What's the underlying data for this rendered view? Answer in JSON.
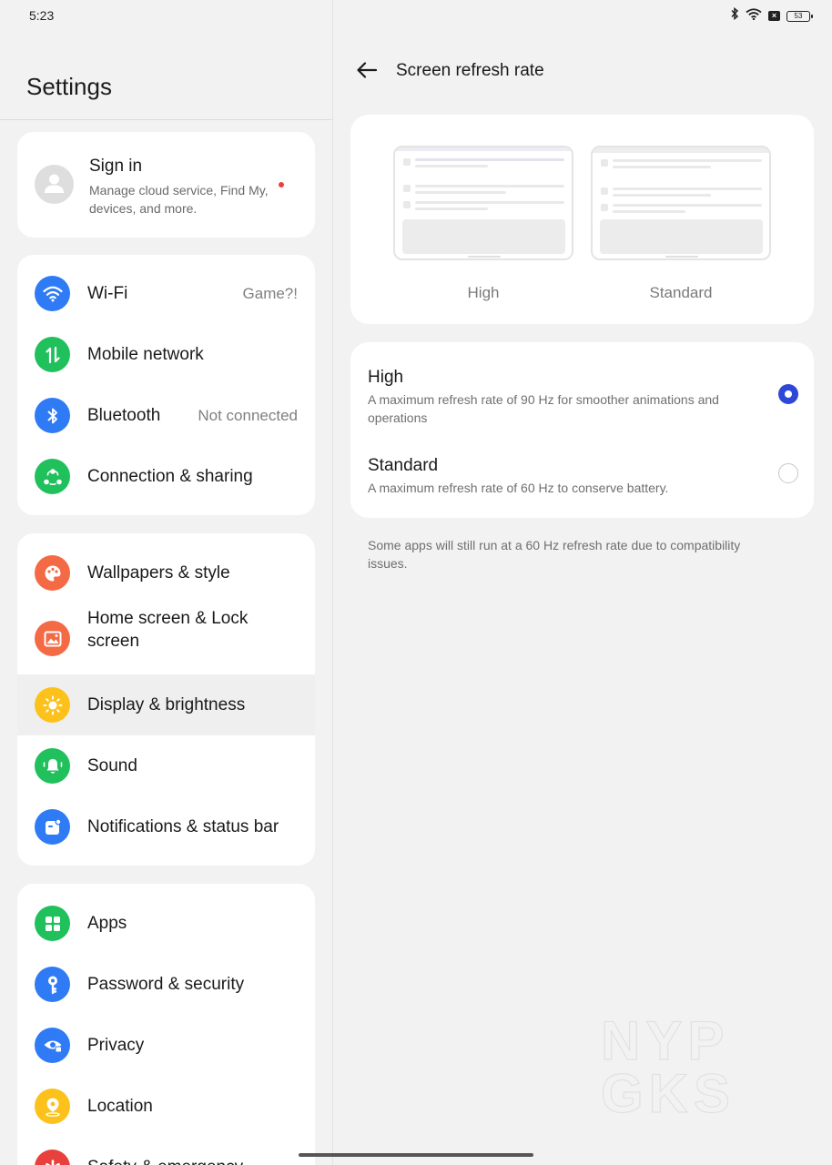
{
  "status": {
    "time": "5:23",
    "battery": "53"
  },
  "left": {
    "title": "Settings",
    "signin": {
      "title": "Sign in",
      "subtitle": "Manage cloud service, Find My, devices, and more."
    },
    "group1": [
      {
        "label": "Wi-Fi",
        "value": "Game?!",
        "icon": "wifi-icon",
        "color": "#2f7bf5"
      },
      {
        "label": "Mobile network",
        "value": "",
        "icon": "mobile-data-icon",
        "color": "#20c05c"
      },
      {
        "label": "Bluetooth",
        "value": "Not connected",
        "icon": "bluetooth-icon",
        "color": "#2f7bf5"
      },
      {
        "label": "Connection & sharing",
        "value": "",
        "icon": "connection-sharing-icon",
        "color": "#20c05c"
      }
    ],
    "group2": [
      {
        "label": "Wallpapers & style",
        "icon": "palette-icon",
        "color": "#f46a45"
      },
      {
        "label": "Home screen & Lock screen",
        "icon": "picture-icon",
        "color": "#f46a45"
      },
      {
        "label": "Display & brightness",
        "icon": "sun-icon",
        "color": "#fcc21b"
      },
      {
        "label": "Sound",
        "icon": "bell-icon",
        "color": "#20c05c"
      },
      {
        "label": "Notifications & status bar",
        "icon": "notification-icon",
        "color": "#2f7bf5"
      }
    ],
    "group3": [
      {
        "label": "Apps",
        "icon": "apps-grid-icon",
        "color": "#20c05c"
      },
      {
        "label": "Password & security",
        "icon": "key-icon",
        "color": "#2f7bf5"
      },
      {
        "label": "Privacy",
        "icon": "privacy-eye-icon",
        "color": "#2f7bf5"
      },
      {
        "label": "Location",
        "icon": "location-icon",
        "color": "#fcc21b"
      },
      {
        "label": "Safety & emergency",
        "icon": "emergency-icon",
        "color": "#e8403c"
      }
    ]
  },
  "right": {
    "title": "Screen refresh rate",
    "preview": {
      "high_label": "High",
      "standard_label": "Standard"
    },
    "options": [
      {
        "title": "High",
        "desc": "A maximum refresh rate of 90 Hz for smoother animations and operations",
        "selected": true
      },
      {
        "title": "Standard",
        "desc": "A maximum refresh rate of 60 Hz to conserve battery.",
        "selected": false
      }
    ],
    "footnote": "Some apps will still run at a 60 Hz refresh rate due to compatibility issues."
  },
  "colors": {
    "accent": "#2f47d6",
    "red_dot": "#e8403c"
  },
  "watermark": "NYPGKS"
}
